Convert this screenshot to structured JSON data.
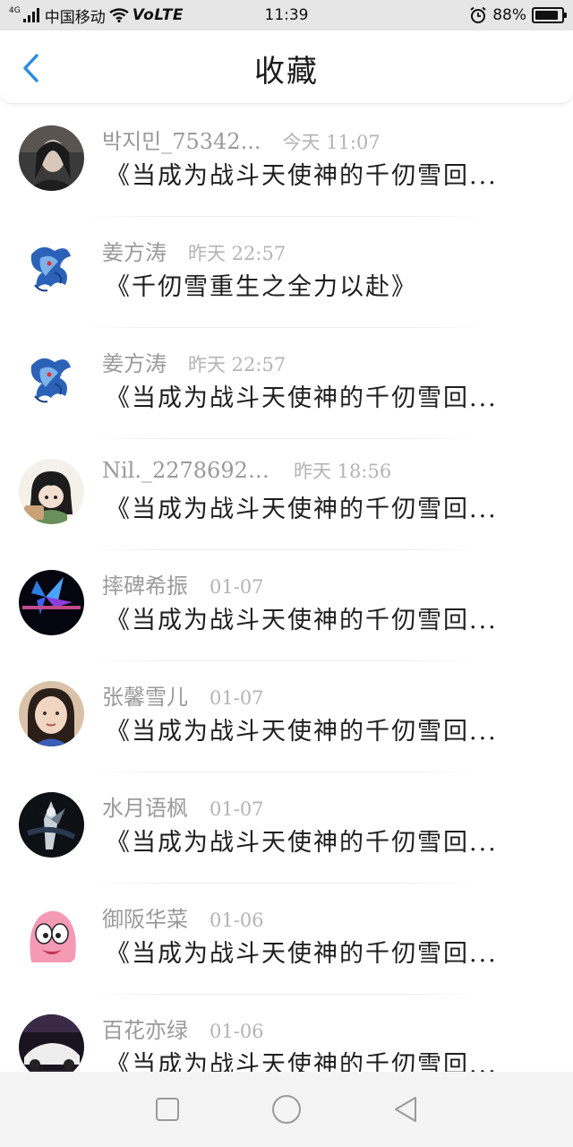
{
  "status_bar": {
    "network_type": "4G",
    "carrier": "中国移动",
    "volte": "VoLTE",
    "time": "11:39",
    "battery_text": "88%",
    "battery_level": 0.88,
    "icons": [
      "signal-icon",
      "wifi-icon",
      "alarm-icon",
      "battery-icon"
    ]
  },
  "header": {
    "title": "收藏",
    "back_icon": "chevron-left-icon",
    "accent_color": "#2a8be0"
  },
  "items": [
    {
      "name": "박지민_75342...",
      "time": "今天 11:07",
      "content": "《当成为战斗天使神的千仞雪回...",
      "avatar": "avatar-dark-portrait"
    },
    {
      "name": "姜方涛",
      "time": "昨天 22:57",
      "content": "《千仞雪重生之全力以赴》",
      "avatar": "avatar-blue-dragon"
    },
    {
      "name": "姜方涛",
      "time": "昨天 22:57",
      "content": "《当成为战斗天使神的千仞雪回...",
      "avatar": "avatar-blue-dragon"
    },
    {
      "name": "Nil._22786929...",
      "time": "昨天 18:56",
      "content": "《当成为战斗天使神的千仞雪回...",
      "avatar": "avatar-anime-girl"
    },
    {
      "name": "摔碑希振",
      "time": "01-07",
      "content": "《当成为战斗天使神的千仞雪回...",
      "avatar": "avatar-dark-blue-star"
    },
    {
      "name": "张馨雪儿",
      "time": "01-07",
      "content": "《当成为战斗天使神的千仞雪回...",
      "avatar": "avatar-girl-photo"
    },
    {
      "name": "水月语枫",
      "time": "01-07",
      "content": "《当成为战斗天使神的千仞雪回...",
      "avatar": "avatar-dark-figure"
    },
    {
      "name": "御阪华菜",
      "time": "01-06",
      "content": "《当成为战斗天使神的千仞雪回...",
      "avatar": "avatar-pink-cartoon"
    },
    {
      "name": "百花亦绿",
      "time": "01-06",
      "content": "《当成为战斗天使神的千仞雪回...",
      "avatar": "avatar-white-car"
    }
  ],
  "nav_bar": {
    "buttons": [
      "square-recent-icon",
      "circle-home-icon",
      "triangle-back-icon"
    ]
  }
}
